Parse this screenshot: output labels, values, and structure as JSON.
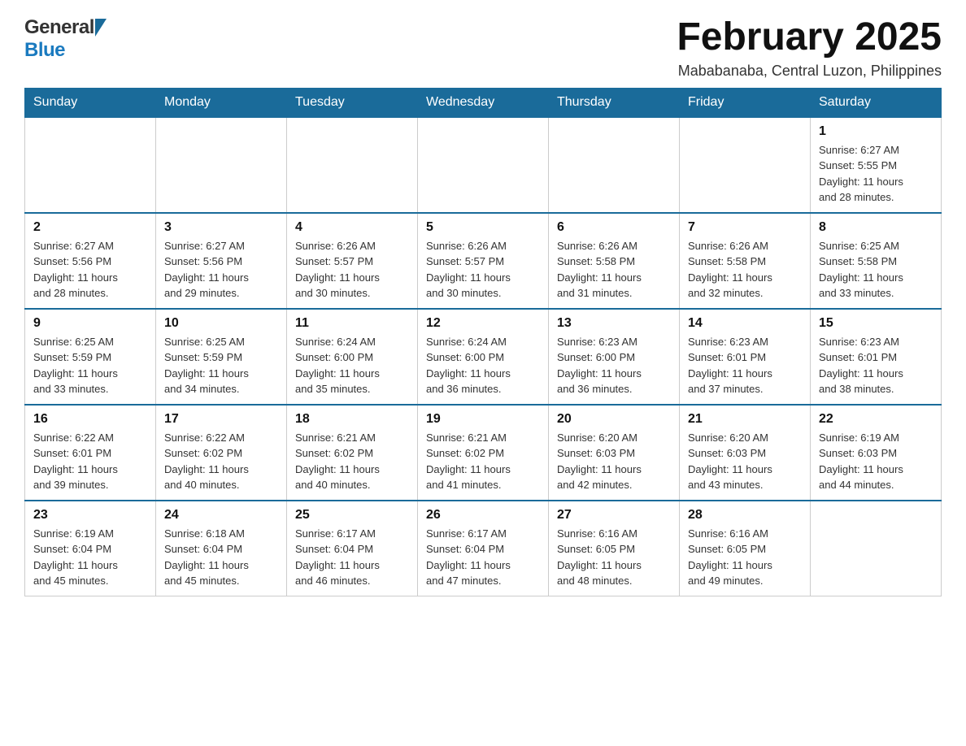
{
  "logo": {
    "general": "General",
    "blue": "Blue"
  },
  "title": "February 2025",
  "location": "Mababanaba, Central Luzon, Philippines",
  "days_of_week": [
    "Sunday",
    "Monday",
    "Tuesday",
    "Wednesday",
    "Thursday",
    "Friday",
    "Saturday"
  ],
  "weeks": [
    [
      {
        "day": "",
        "info": ""
      },
      {
        "day": "",
        "info": ""
      },
      {
        "day": "",
        "info": ""
      },
      {
        "day": "",
        "info": ""
      },
      {
        "day": "",
        "info": ""
      },
      {
        "day": "",
        "info": ""
      },
      {
        "day": "1",
        "info": "Sunrise: 6:27 AM\nSunset: 5:55 PM\nDaylight: 11 hours\nand 28 minutes."
      }
    ],
    [
      {
        "day": "2",
        "info": "Sunrise: 6:27 AM\nSunset: 5:56 PM\nDaylight: 11 hours\nand 28 minutes."
      },
      {
        "day": "3",
        "info": "Sunrise: 6:27 AM\nSunset: 5:56 PM\nDaylight: 11 hours\nand 29 minutes."
      },
      {
        "day": "4",
        "info": "Sunrise: 6:26 AM\nSunset: 5:57 PM\nDaylight: 11 hours\nand 30 minutes."
      },
      {
        "day": "5",
        "info": "Sunrise: 6:26 AM\nSunset: 5:57 PM\nDaylight: 11 hours\nand 30 minutes."
      },
      {
        "day": "6",
        "info": "Sunrise: 6:26 AM\nSunset: 5:58 PM\nDaylight: 11 hours\nand 31 minutes."
      },
      {
        "day": "7",
        "info": "Sunrise: 6:26 AM\nSunset: 5:58 PM\nDaylight: 11 hours\nand 32 minutes."
      },
      {
        "day": "8",
        "info": "Sunrise: 6:25 AM\nSunset: 5:58 PM\nDaylight: 11 hours\nand 33 minutes."
      }
    ],
    [
      {
        "day": "9",
        "info": "Sunrise: 6:25 AM\nSunset: 5:59 PM\nDaylight: 11 hours\nand 33 minutes."
      },
      {
        "day": "10",
        "info": "Sunrise: 6:25 AM\nSunset: 5:59 PM\nDaylight: 11 hours\nand 34 minutes."
      },
      {
        "day": "11",
        "info": "Sunrise: 6:24 AM\nSunset: 6:00 PM\nDaylight: 11 hours\nand 35 minutes."
      },
      {
        "day": "12",
        "info": "Sunrise: 6:24 AM\nSunset: 6:00 PM\nDaylight: 11 hours\nand 36 minutes."
      },
      {
        "day": "13",
        "info": "Sunrise: 6:23 AM\nSunset: 6:00 PM\nDaylight: 11 hours\nand 36 minutes."
      },
      {
        "day": "14",
        "info": "Sunrise: 6:23 AM\nSunset: 6:01 PM\nDaylight: 11 hours\nand 37 minutes."
      },
      {
        "day": "15",
        "info": "Sunrise: 6:23 AM\nSunset: 6:01 PM\nDaylight: 11 hours\nand 38 minutes."
      }
    ],
    [
      {
        "day": "16",
        "info": "Sunrise: 6:22 AM\nSunset: 6:01 PM\nDaylight: 11 hours\nand 39 minutes."
      },
      {
        "day": "17",
        "info": "Sunrise: 6:22 AM\nSunset: 6:02 PM\nDaylight: 11 hours\nand 40 minutes."
      },
      {
        "day": "18",
        "info": "Sunrise: 6:21 AM\nSunset: 6:02 PM\nDaylight: 11 hours\nand 40 minutes."
      },
      {
        "day": "19",
        "info": "Sunrise: 6:21 AM\nSunset: 6:02 PM\nDaylight: 11 hours\nand 41 minutes."
      },
      {
        "day": "20",
        "info": "Sunrise: 6:20 AM\nSunset: 6:03 PM\nDaylight: 11 hours\nand 42 minutes."
      },
      {
        "day": "21",
        "info": "Sunrise: 6:20 AM\nSunset: 6:03 PM\nDaylight: 11 hours\nand 43 minutes."
      },
      {
        "day": "22",
        "info": "Sunrise: 6:19 AM\nSunset: 6:03 PM\nDaylight: 11 hours\nand 44 minutes."
      }
    ],
    [
      {
        "day": "23",
        "info": "Sunrise: 6:19 AM\nSunset: 6:04 PM\nDaylight: 11 hours\nand 45 minutes."
      },
      {
        "day": "24",
        "info": "Sunrise: 6:18 AM\nSunset: 6:04 PM\nDaylight: 11 hours\nand 45 minutes."
      },
      {
        "day": "25",
        "info": "Sunrise: 6:17 AM\nSunset: 6:04 PM\nDaylight: 11 hours\nand 46 minutes."
      },
      {
        "day": "26",
        "info": "Sunrise: 6:17 AM\nSunset: 6:04 PM\nDaylight: 11 hours\nand 47 minutes."
      },
      {
        "day": "27",
        "info": "Sunrise: 6:16 AM\nSunset: 6:05 PM\nDaylight: 11 hours\nand 48 minutes."
      },
      {
        "day": "28",
        "info": "Sunrise: 6:16 AM\nSunset: 6:05 PM\nDaylight: 11 hours\nand 49 minutes."
      },
      {
        "day": "",
        "info": ""
      }
    ]
  ]
}
